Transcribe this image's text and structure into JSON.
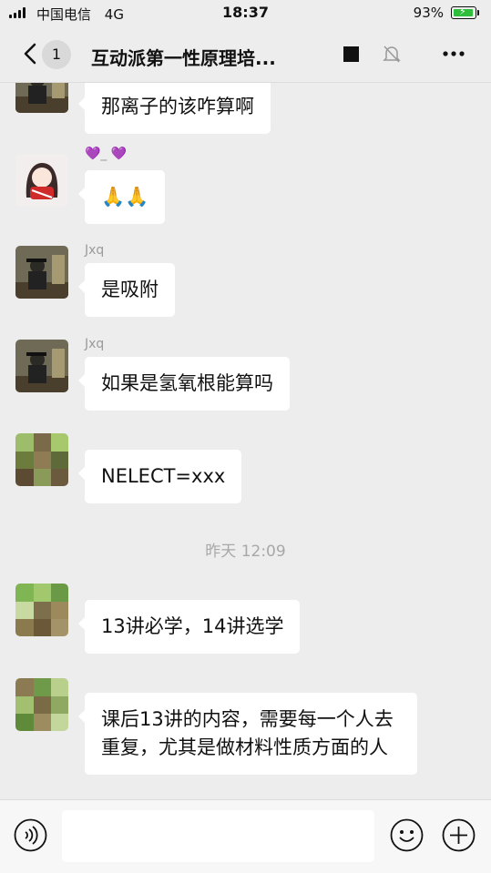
{
  "status_bar": {
    "carrier": "中国电信",
    "network": "4G",
    "time": "18:37",
    "battery_percent": "93%",
    "battery_level": 0.93
  },
  "nav": {
    "unread_count": "1",
    "title": "互动派第一性原理培..."
  },
  "messages": [
    {
      "sender": "",
      "text": "那离子的该咋算啊"
    },
    {
      "sender": "💜_  💜",
      "text": "🙏🙏"
    },
    {
      "sender": "Jxq",
      "text": "是吸附"
    },
    {
      "sender": "Jxq",
      "text": "如果是氢氧根能算吗"
    },
    {
      "sender": "",
      "text": "NELECT=xxx"
    },
    {
      "sender": "",
      "text": "13讲必学，14讲选学"
    },
    {
      "sender": "",
      "text": "课后13讲的内容，需要每一个人去重复，尤其是做材料性质方面的人"
    }
  ],
  "timestamp": "昨天 12:09",
  "colors": {
    "background": "#ededed",
    "bubble": "#ffffff",
    "battery": "#2fbe3c",
    "muted_text": "#9a9a9a"
  },
  "icons": {
    "voice": "voice-icon",
    "emoji": "emoji-icon",
    "plus": "plus-icon",
    "more": "more-icon",
    "mute": "bell-muted-icon"
  }
}
